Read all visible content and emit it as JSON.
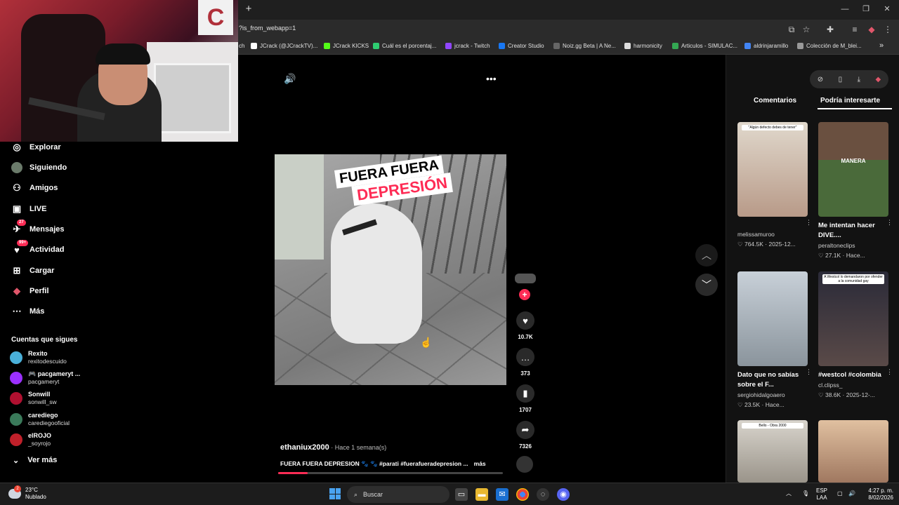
{
  "browser": {
    "url": "?is_from_webapp=1",
    "new_tab": "+",
    "bookmarks": [
      {
        "label": "ch",
        "color": "#888"
      },
      {
        "label": "JCrack (@JCrackTV)...",
        "color": "#000"
      },
      {
        "label": "JCrack KICKS",
        "color": "#53fc18"
      },
      {
        "label": "Cuál es el porcentaj...",
        "color": "#2ecc71"
      },
      {
        "label": "jcrack - Twitch",
        "color": "#9146ff"
      },
      {
        "label": "Creator Studio",
        "color": "#1877f2"
      },
      {
        "label": "Noiz.gg Beta | A Ne...",
        "color": "#666"
      },
      {
        "label": "harmonicity",
        "color": "#ddd"
      },
      {
        "label": "Articulos - SIMULAC...",
        "color": "#34a853"
      },
      {
        "label": "aldrinjaramillo",
        "color": "#4285f4"
      },
      {
        "label": "Colección de M_blei...",
        "color": "#999"
      }
    ],
    "more_bookmarks": "»"
  },
  "sidebar": {
    "items": [
      {
        "label": "Explorar",
        "icon": "compass-icon",
        "glyph": "◎"
      },
      {
        "label": "Siguiendo",
        "icon": "following-avatar-icon",
        "glyph": "●"
      },
      {
        "label": "Amigos",
        "icon": "friends-icon",
        "glyph": "⚇"
      },
      {
        "label": "LIVE",
        "icon": "live-icon",
        "glyph": "▣"
      },
      {
        "label": "Mensajes",
        "icon": "messages-icon",
        "glyph": "✈",
        "badge": "27"
      },
      {
        "label": "Actividad",
        "icon": "activity-icon",
        "glyph": "●",
        "badge": "99+"
      },
      {
        "label": "Cargar",
        "icon": "upload-icon",
        "glyph": "⊞"
      },
      {
        "label": "Perfil",
        "icon": "profile-icon",
        "glyph": "♞"
      },
      {
        "label": "Más",
        "icon": "more-icon",
        "glyph": "⋯"
      }
    ],
    "following_title": "Cuentas que sigues",
    "accounts": [
      {
        "name": "Rexito",
        "handle": "rexitodescuido",
        "color": "#4ab0d9"
      },
      {
        "name": "🎮 pacgameryt ...",
        "handle": "pacgameryt",
        "color": "#9b30ff"
      },
      {
        "name": "Sonwill",
        "handle": "sonwill_sw",
        "color": "#b01030"
      },
      {
        "name": "carediego",
        "handle": "carediegooficial",
        "color": "#3a7a5a"
      },
      {
        "name": "elROJO",
        "handle": "_soyrojo",
        "color": "#c0202a"
      }
    ],
    "see_more": "Ver más",
    "see_more_icon": "⌄"
  },
  "video": {
    "caption_line1": "FUERA FUERA",
    "caption_line2": "DEPRESIÓN",
    "author": "ethaniux2000",
    "time": " · Hace 1 semana(s)",
    "description": "FUERA FUERA DEPRESION 🐾 🐾 #parati #fuerafueradepresion ...",
    "more": "más",
    "progress": 0.13,
    "likes": "10.7K",
    "comments": "373",
    "saves": "1707",
    "shares": "7326"
  },
  "right_panel": {
    "tab_comments": "Comentarios",
    "tab_interest": "Podría interesarte",
    "cards": [
      {
        "title": "",
        "user": "melissamuroo",
        "meta": "♡ 764.5K · 2025-12...",
        "thumb_text": "\"Algún defecto debes de tener\"",
        "bg": "#d8cfc4"
      },
      {
        "title": "Me intentan hacer DIVE....",
        "user": "peraltoneclips",
        "meta": "♡ 27.1K · Hace...",
        "thumb_text": "MANERA",
        "bg": "#5a6a4a"
      },
      {
        "title": "Dato que no sabías sobre el F...",
        "user": "sergiohidalgoaero",
        "meta": "♡ 23.5K · Hace...",
        "thumb_text": "",
        "bg": "#a8b4be"
      },
      {
        "title": "#westcol #colombia",
        "user": "cl.clipss_",
        "meta": "♡ 38.6K · 2025-12-...",
        "thumb_text": "A Westcol lo demandaron por ofender a la comunidad gay",
        "bg": "#3a3a4a"
      },
      {
        "title": "",
        "user": "",
        "meta": "",
        "thumb_text": "Bello - Obra 2000",
        "bg": "#cfcac0"
      },
      {
        "title": "",
        "user": "",
        "meta": "",
        "thumb_text": "",
        "bg": "#b89a80"
      }
    ]
  },
  "taskbar": {
    "temp": "23°C",
    "weather": "Nublado",
    "weather_badge": "2",
    "search": "Buscar",
    "lang1": "ESP",
    "lang2": "LAA",
    "time": "4:27 p. m.",
    "date": "8/02/2026"
  }
}
